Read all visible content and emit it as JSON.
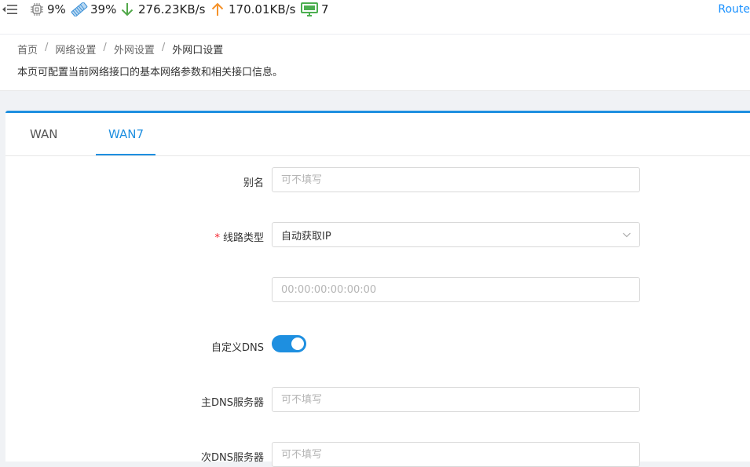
{
  "status": {
    "cpu": "9%",
    "memory": "39%",
    "download": "276.23KB/s",
    "upload": "170.01KB/s",
    "devices": "7",
    "route_link": "Route"
  },
  "breadcrumb": {
    "items": [
      "首页",
      "网络设置",
      "外网设置"
    ],
    "current": "外网口设置"
  },
  "page_description": "本页可配置当前网络接口的基本网络参数和相关接口信息。",
  "tabs": [
    {
      "label": "WAN",
      "active": false
    },
    {
      "label": "WAN7",
      "active": true
    }
  ],
  "form": {
    "alias": {
      "label": "别名",
      "placeholder": "可不填写"
    },
    "line_type": {
      "label": "线路类型",
      "required": true,
      "value": "自动获取IP"
    },
    "mac": {
      "placeholder": "00:00:00:00:00:00"
    },
    "custom_dns": {
      "label": "自定义DNS",
      "enabled": true
    },
    "primary_dns": {
      "label": "主DNS服务器",
      "placeholder": "可不填写"
    },
    "secondary_dns": {
      "label": "次DNS服务器",
      "placeholder": "可不填写"
    }
  },
  "colors": {
    "accent": "#1e8fe0",
    "download_arrow": "#52a84a",
    "upload_arrow": "#f5922a",
    "device_icon": "#4caf50"
  }
}
